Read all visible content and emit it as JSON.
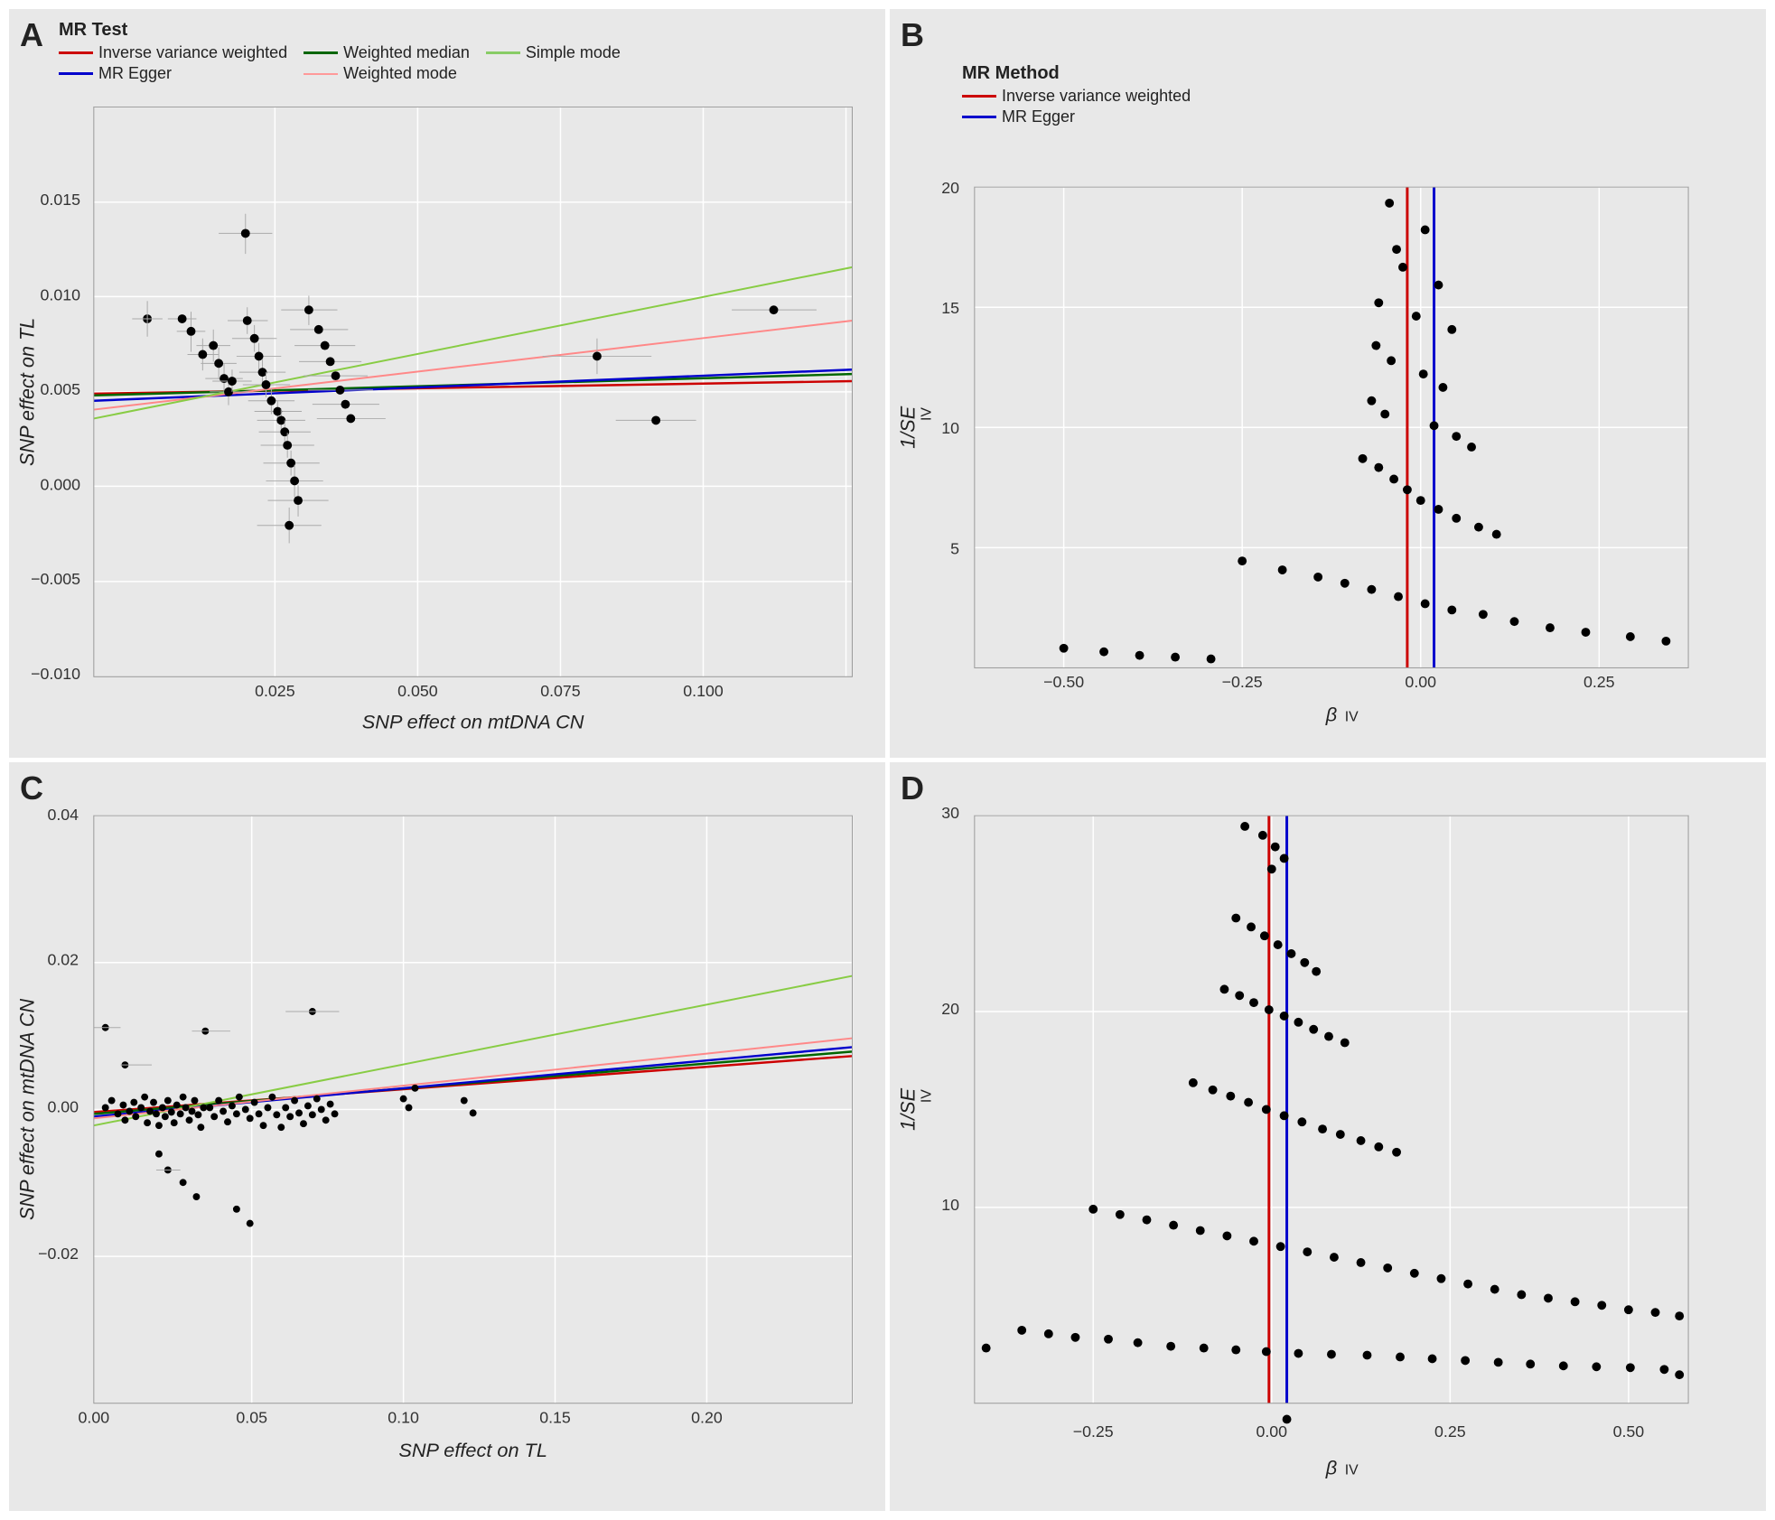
{
  "panels": {
    "A": {
      "label": "A",
      "x_axis_label": "SNP effect on mtDNA CN",
      "y_axis_label": "SNP effect on TL",
      "x_ticks": [
        "0.025",
        "0.050",
        "0.075",
        "0.100"
      ],
      "y_ticks": [
        "-0.010",
        "-0.005",
        "0.000",
        "0.005",
        "0.010",
        "0.015"
      ],
      "legend_title": "MR Test",
      "legend_items": [
        {
          "label": "Inverse variance weighted",
          "color": "#cc0000"
        },
        {
          "label": "Weighted median",
          "color": "#006600"
        },
        {
          "label": "MR Egger",
          "color": "#0000cc"
        },
        {
          "label": "Weighted mode",
          "color": "#ff9999"
        },
        {
          "label": "Simple mode",
          "color": "#99cc99"
        }
      ]
    },
    "B": {
      "label": "B",
      "x_axis_label": "β_IV",
      "y_axis_label": "1/SE_IV",
      "x_ticks": [
        "-0.50",
        "-0.25",
        "0.00",
        "0.25"
      ],
      "y_ticks": [
        "5",
        "10",
        "15",
        "20"
      ],
      "legend_title": "MR Method",
      "legend_items": [
        {
          "label": "Inverse variance weighted",
          "color": "#cc0000"
        },
        {
          "label": "MR Egger",
          "color": "#0000cc"
        }
      ]
    },
    "C": {
      "label": "C",
      "x_axis_label": "SNP effect on TL",
      "y_axis_label": "SNP effect on mtDNA CN",
      "x_ticks": [
        "0.00",
        "0.05",
        "0.10",
        "0.15",
        "0.20"
      ],
      "y_ticks": [
        "-0.02",
        "0.00",
        "0.02",
        "0.04"
      ],
      "legend_items": []
    },
    "D": {
      "label": "D",
      "x_axis_label": "β_IV",
      "y_axis_label": "1/SE_IV",
      "x_ticks": [
        "-0.25",
        "0.00",
        "0.25",
        "0.50"
      ],
      "y_ticks": [
        "10",
        "20",
        "30"
      ],
      "legend_items": []
    }
  }
}
